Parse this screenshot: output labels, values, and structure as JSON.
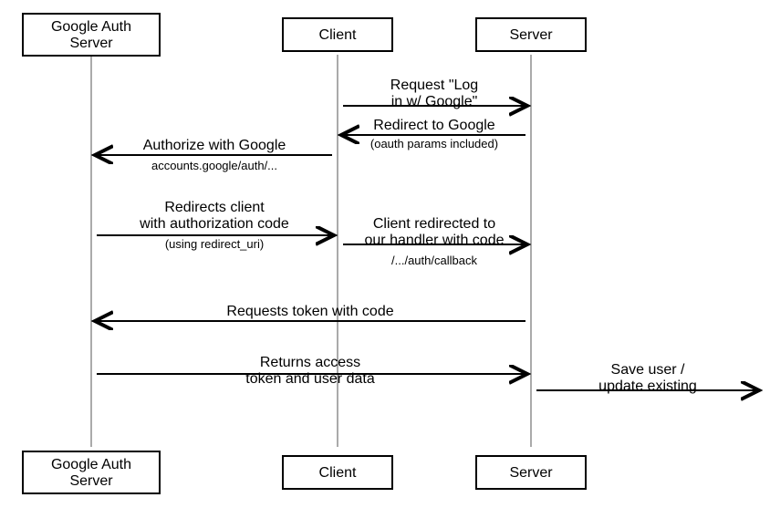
{
  "participants": {
    "google": "Google Auth Server",
    "client": "Client",
    "server": "Server"
  },
  "messages": {
    "m1": {
      "label": "Request \"Log in w/ Google\"",
      "sub": ""
    },
    "m2": {
      "label": "Redirect to Google",
      "sub": "(oauth params included)"
    },
    "m3": {
      "label": "Authorize with Google",
      "sub": "accounts.google/auth/..."
    },
    "m4": {
      "label": "Redirects client with authorization code",
      "sub": "(using redirect_uri)"
    },
    "m5": {
      "label": "Client redirected to our handler with code",
      "sub": "/.../auth/callback"
    },
    "m6": {
      "label": "Requests token with code",
      "sub": ""
    },
    "m7": {
      "label": "Returns access token and user data",
      "sub": ""
    },
    "m8": {
      "label": "Save user / update existing",
      "sub": ""
    }
  }
}
